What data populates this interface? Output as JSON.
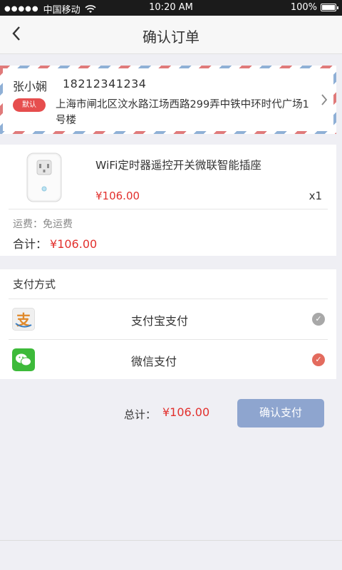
{
  "status_bar": {
    "signal_dots": "●●●●●",
    "carrier": "中国移动",
    "time": "10:20 AM",
    "battery": "100%"
  },
  "nav": {
    "back_icon": "chevron-left",
    "title": "确认订单"
  },
  "address": {
    "name": "张小娴",
    "phone": "18212341234",
    "badge": "默认",
    "detail": "上海市闸北区汶水路江场西路299弄中铁中环时代广场1号楼"
  },
  "product": {
    "name": "WiFi定时器遥控开关微联智能插座",
    "price": "¥106.00",
    "quantity": "x1",
    "shipping": "运费：免运费",
    "subtotal_label": "合计：",
    "subtotal_amount": "¥106.00"
  },
  "payment": {
    "header": "支付方式",
    "options": [
      {
        "label": "支付宝支付",
        "icon": "alipay-icon",
        "selected": false
      },
      {
        "label": "微信支付",
        "icon": "wechat-icon",
        "selected": true
      }
    ]
  },
  "footer": {
    "total_label": "总计：",
    "total_amount": "¥106.00",
    "confirm_label": "确认支付"
  },
  "colors": {
    "accent_red": "#e2302d",
    "confirm_button": "#8ea5cf",
    "badge_red": "#e64e4e",
    "selected_radio": "#e36b5e",
    "unselected_radio": "#a8a8a8"
  }
}
